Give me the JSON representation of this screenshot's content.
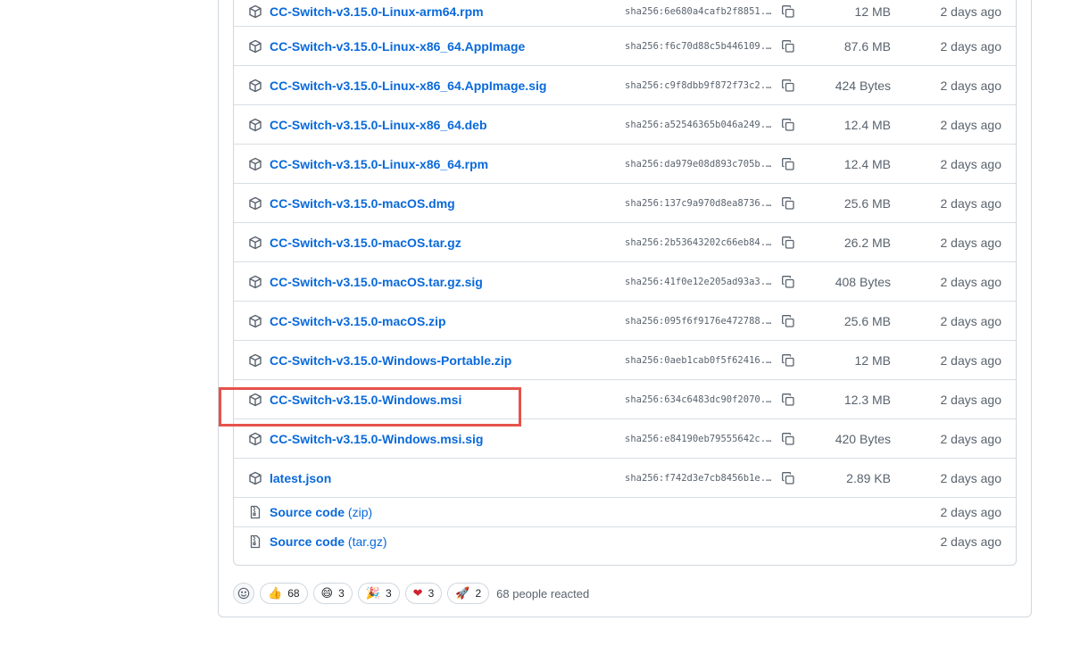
{
  "assets": [
    {
      "name": "CC-Switch-v3.15.0-Linux-arm64.rpm",
      "sha": "sha256:6e680a4cafb2f8851...",
      "size": "12 MB",
      "date": "2 days ago"
    },
    {
      "name": "CC-Switch-v3.15.0-Linux-x86_64.AppImage",
      "sha": "sha256:f6c70d88c5b446109...",
      "size": "87.6 MB",
      "date": "2 days ago"
    },
    {
      "name": "CC-Switch-v3.15.0-Linux-x86_64.AppImage.sig",
      "sha": "sha256:c9f8dbb9f872f73c2...",
      "size": "424 Bytes",
      "date": "2 days ago"
    },
    {
      "name": "CC-Switch-v3.15.0-Linux-x86_64.deb",
      "sha": "sha256:a52546365b046a249...",
      "size": "12.4 MB",
      "date": "2 days ago"
    },
    {
      "name": "CC-Switch-v3.15.0-Linux-x86_64.rpm",
      "sha": "sha256:da979e08d893c705b...",
      "size": "12.4 MB",
      "date": "2 days ago"
    },
    {
      "name": "CC-Switch-v3.15.0-macOS.dmg",
      "sha": "sha256:137c9a970d8ea8736...",
      "size": "25.6 MB",
      "date": "2 days ago"
    },
    {
      "name": "CC-Switch-v3.15.0-macOS.tar.gz",
      "sha": "sha256:2b53643202c66eb84...",
      "size": "26.2 MB",
      "date": "2 days ago"
    },
    {
      "name": "CC-Switch-v3.15.0-macOS.tar.gz.sig",
      "sha": "sha256:41f0e12e205ad93a3...",
      "size": "408 Bytes",
      "date": "2 days ago"
    },
    {
      "name": "CC-Switch-v3.15.0-macOS.zip",
      "sha": "sha256:095f6f9176e472788...",
      "size": "25.6 MB",
      "date": "2 days ago"
    },
    {
      "name": "CC-Switch-v3.15.0-Windows-Portable.zip",
      "sha": "sha256:0aeb1cab0f5f62416...",
      "size": "12 MB",
      "date": "2 days ago"
    },
    {
      "name": "CC-Switch-v3.15.0-Windows.msi",
      "sha": "sha256:634c6483dc90f2070...",
      "size": "12.3 MB",
      "date": "2 days ago"
    },
    {
      "name": "CC-Switch-v3.15.0-Windows.msi.sig",
      "sha": "sha256:e84190eb79555642c...",
      "size": "420 Bytes",
      "date": "2 days ago"
    },
    {
      "name": "latest.json",
      "sha": "sha256:f742d3e7cb8456b1e...",
      "size": "2.89 KB",
      "date": "2 days ago"
    }
  ],
  "source_code": [
    {
      "label": "Source code",
      "format": "(zip)",
      "date": "2 days ago"
    },
    {
      "label": "Source code",
      "format": "(tar.gz)",
      "date": "2 days ago"
    }
  ],
  "highlighted_asset": "CC-Switch-v3.15.0-Windows.msi",
  "highlight_color": "#e5534b",
  "link_color": "#0969da",
  "reactions": [
    {
      "icon": "thumbs-up",
      "emoji": "👍",
      "count": "68"
    },
    {
      "icon": "laugh",
      "emoji": "😄",
      "count": "3"
    },
    {
      "icon": "hooray",
      "emoji": "🎉",
      "count": "3"
    },
    {
      "icon": "heart",
      "emoji": "❤",
      "count": "3"
    },
    {
      "icon": "rocket",
      "emoji": "🚀",
      "count": "2"
    }
  ],
  "reactions_summary": "68 people reacted"
}
